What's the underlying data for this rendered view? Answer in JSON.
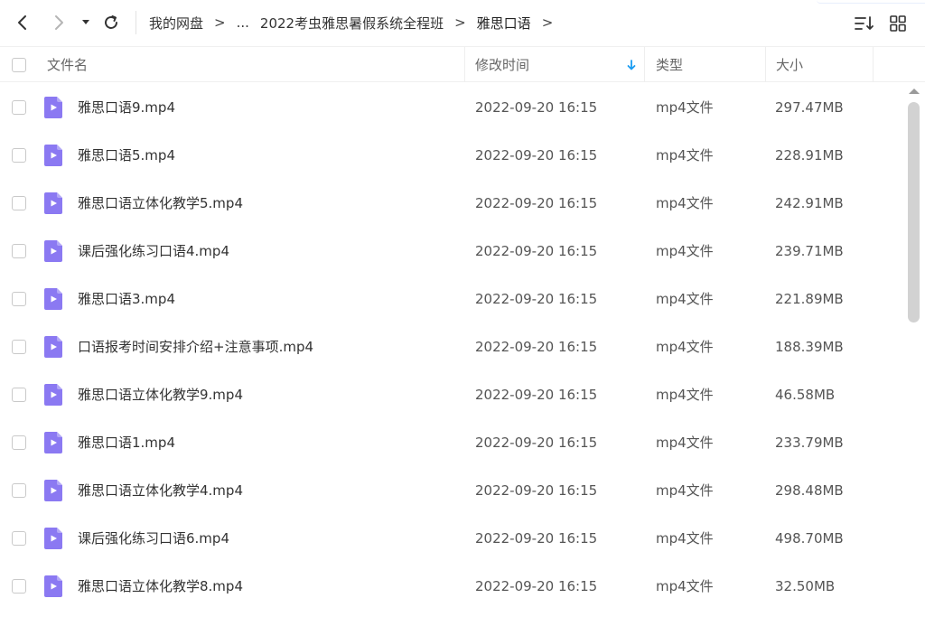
{
  "toolbar": {
    "back_icon": "chevron-left-icon",
    "forward_icon": "chevron-right-icon",
    "history_icon": "caret-down-icon",
    "refresh_icon": "refresh-icon",
    "sort_icon": "sort-list-icon",
    "grid_icon": "grid-view-icon"
  },
  "breadcrumb": {
    "root": "我的网盘",
    "ellipsis": "...",
    "parent": "2022考虫雅思暑假系统全程班",
    "current": "雅思口语",
    "separator": ">"
  },
  "table": {
    "headers": {
      "name": "文件名",
      "modified": "修改时间",
      "type": "类型",
      "size": "大小"
    },
    "sort_indicator_color": "#1a9cf2",
    "file_icon_color": "#8b79f2",
    "rows": [
      {
        "name": "雅思口语9.mp4",
        "modified": "2022-09-20 16:15",
        "type": "mp4文件",
        "size": "297.47MB"
      },
      {
        "name": "雅思口语5.mp4",
        "modified": "2022-09-20 16:15",
        "type": "mp4文件",
        "size": "228.91MB"
      },
      {
        "name": "雅思口语立体化教学5.mp4",
        "modified": "2022-09-20 16:15",
        "type": "mp4文件",
        "size": "242.91MB"
      },
      {
        "name": "课后强化练习口语4.mp4",
        "modified": "2022-09-20 16:15",
        "type": "mp4文件",
        "size": "239.71MB"
      },
      {
        "name": "雅思口语3.mp4",
        "modified": "2022-09-20 16:15",
        "type": "mp4文件",
        "size": "221.89MB"
      },
      {
        "name": "口语报考时间安排介绍+注意事项.mp4",
        "modified": "2022-09-20 16:15",
        "type": "mp4文件",
        "size": "188.39MB"
      },
      {
        "name": "雅思口语立体化教学9.mp4",
        "modified": "2022-09-20 16:15",
        "type": "mp4文件",
        "size": "46.58MB"
      },
      {
        "name": "雅思口语1.mp4",
        "modified": "2022-09-20 16:15",
        "type": "mp4文件",
        "size": "233.79MB"
      },
      {
        "name": "雅思口语立体化教学4.mp4",
        "modified": "2022-09-20 16:15",
        "type": "mp4文件",
        "size": "298.48MB"
      },
      {
        "name": "课后强化练习口语6.mp4",
        "modified": "2022-09-20 16:15",
        "type": "mp4文件",
        "size": "498.70MB"
      },
      {
        "name": "雅思口语立体化教学8.mp4",
        "modified": "2022-09-20 16:15",
        "type": "mp4文件",
        "size": "32.50MB"
      }
    ]
  }
}
